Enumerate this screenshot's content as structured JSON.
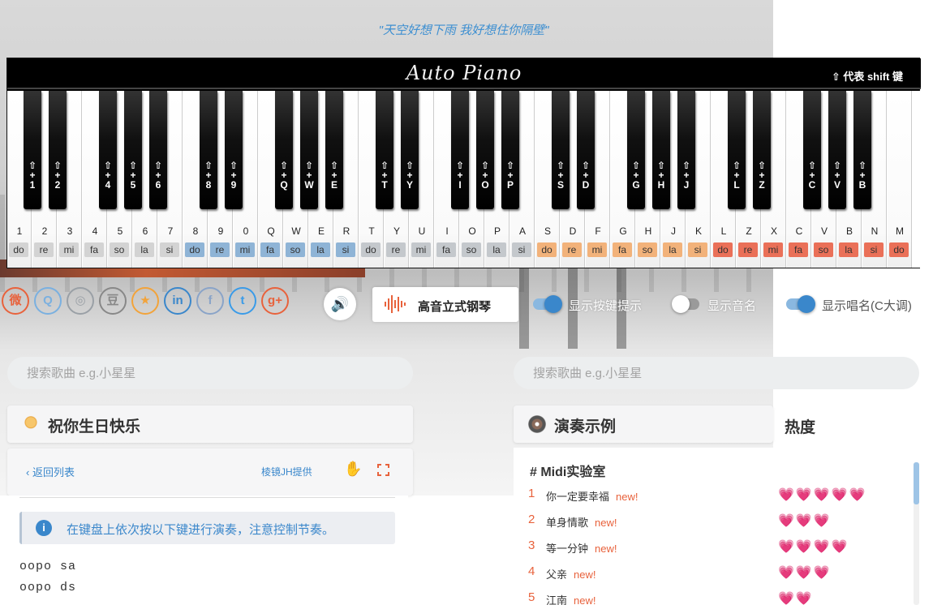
{
  "quote": "\"天空好想下雨 我好想住你隔壁\"",
  "piano": {
    "logo": "Auto Piano",
    "shift_hint": "⇧ 代表 shift 键",
    "white_keys": [
      {
        "key": "1",
        "note": "do",
        "color": "#d3d3d3"
      },
      {
        "key": "2",
        "note": "re",
        "color": "#d3d3d3"
      },
      {
        "key": "3",
        "note": "mi",
        "color": "#d3d3d3"
      },
      {
        "key": "4",
        "note": "fa",
        "color": "#d3d3d3"
      },
      {
        "key": "5",
        "note": "so",
        "color": "#d3d3d3"
      },
      {
        "key": "6",
        "note": "la",
        "color": "#d3d3d3"
      },
      {
        "key": "7",
        "note": "si",
        "color": "#d3d3d3"
      },
      {
        "key": "8",
        "note": "do",
        "color": "#8fb4d6"
      },
      {
        "key": "9",
        "note": "re",
        "color": "#8fb4d6"
      },
      {
        "key": "0",
        "note": "mi",
        "color": "#8fb4d6"
      },
      {
        "key": "Q",
        "note": "fa",
        "color": "#8fb4d6"
      },
      {
        "key": "W",
        "note": "so",
        "color": "#8fb4d6"
      },
      {
        "key": "E",
        "note": "la",
        "color": "#8fb4d6"
      },
      {
        "key": "R",
        "note": "si",
        "color": "#8fb4d6"
      },
      {
        "key": "T",
        "note": "do",
        "color": "#c4c8cc"
      },
      {
        "key": "Y",
        "note": "re",
        "color": "#c4c8cc"
      },
      {
        "key": "U",
        "note": "mi",
        "color": "#c4c8cc"
      },
      {
        "key": "I",
        "note": "fa",
        "color": "#c4c8cc"
      },
      {
        "key": "O",
        "note": "so",
        "color": "#c4c8cc"
      },
      {
        "key": "P",
        "note": "la",
        "color": "#c4c8cc"
      },
      {
        "key": "A",
        "note": "si",
        "color": "#c4c8cc"
      },
      {
        "key": "S",
        "note": "do",
        "color": "#f2b27a"
      },
      {
        "key": "D",
        "note": "re",
        "color": "#f2b27a"
      },
      {
        "key": "F",
        "note": "mi",
        "color": "#f2b27a"
      },
      {
        "key": "G",
        "note": "fa",
        "color": "#f2b27a"
      },
      {
        "key": "H",
        "note": "so",
        "color": "#f2b27a"
      },
      {
        "key": "J",
        "note": "la",
        "color": "#f2b27a"
      },
      {
        "key": "K",
        "note": "si",
        "color": "#f2b27a"
      },
      {
        "key": "L",
        "note": "do",
        "color": "#ea7058"
      },
      {
        "key": "Z",
        "note": "re",
        "color": "#ea7058"
      },
      {
        "key": "X",
        "note": "mi",
        "color": "#ea7058"
      },
      {
        "key": "C",
        "note": "fa",
        "color": "#ea7058"
      },
      {
        "key": "V",
        "note": "so",
        "color": "#ea7058"
      },
      {
        "key": "B",
        "note": "la",
        "color": "#ea7058"
      },
      {
        "key": "N",
        "note": "si",
        "color": "#ea7058"
      },
      {
        "key": "M",
        "note": "do",
        "color": "#ea7058"
      }
    ],
    "black_keys": [
      "⇧ + 1",
      "⇧ + 2",
      "⇧ + 4",
      "⇧ + 5",
      "⇧ + 6",
      "⇧ + 8",
      "⇧ + 9",
      "⇧ + Q",
      "⇧ + W",
      "⇧ + E",
      "⇧ + T",
      "⇧ + Y",
      "⇧ + I",
      "⇧ + O",
      "⇧ + P",
      "⇧ + S",
      "⇧ + D",
      "⇧ + G",
      "⇧ + H",
      "⇧ + J",
      "⇧ + L",
      "⇧ + Z",
      "⇧ + C",
      "⇧ + V",
      "⇧ + B"
    ]
  },
  "social_icons": [
    {
      "name": "weibo-icon",
      "glyph": "微",
      "color": "#e8623c"
    },
    {
      "name": "qq-icon",
      "glyph": "Q",
      "color": "#7ab0e0"
    },
    {
      "name": "wechat-icon",
      "glyph": "◎",
      "color": "#9aa0a6"
    },
    {
      "name": "douban-icon",
      "glyph": "豆",
      "color": "#888"
    },
    {
      "name": "qzone-icon",
      "glyph": "★",
      "color": "#f2a33a"
    },
    {
      "name": "linkedin-icon",
      "glyph": "in",
      "color": "#3a87cb"
    },
    {
      "name": "facebook-icon",
      "glyph": "f",
      "color": "#8aa4c8"
    },
    {
      "name": "twitter-icon",
      "glyph": "t",
      "color": "#3a9be8"
    },
    {
      "name": "google-plus-icon",
      "glyph": "g+",
      "color": "#e8623c"
    }
  ],
  "instrument": {
    "name": "高音立式钢琴"
  },
  "toggles": [
    {
      "label": "显示按键提示",
      "on": true
    },
    {
      "label": "显示音名",
      "on": false
    },
    {
      "label": "显示唱名(C大调)",
      "on": true
    }
  ],
  "search": {
    "placeholder": "搜索歌曲 e.g.小星星"
  },
  "song_panel": {
    "title": "祝你生日快乐",
    "back_label": "返回列表",
    "provider": "棱镜JH提供",
    "tip": "在键盘上依次按以下键进行演奏，注意控制节奏。",
    "sheet_lines": [
      "oopo sa",
      "oopo ds"
    ]
  },
  "examples": {
    "title": "演奏示例",
    "hot_label": "热度",
    "category": "# Midi实验室",
    "new_label": "new!",
    "songs": [
      {
        "num": "1",
        "name": "你一定要幸福",
        "hearts": "💗💗💗💗💗"
      },
      {
        "num": "2",
        "name": "单身情歌",
        "hearts": "💗💗💗"
      },
      {
        "num": "3",
        "name": "等一分钟",
        "hearts": "💗💗💗💗"
      },
      {
        "num": "4",
        "name": "父亲",
        "hearts": "💗💗💗"
      },
      {
        "num": "5",
        "name": "江南",
        "hearts": "💗💗"
      }
    ]
  },
  "colors": {
    "accent": "#3a87cb",
    "orange": "#e8623c"
  }
}
